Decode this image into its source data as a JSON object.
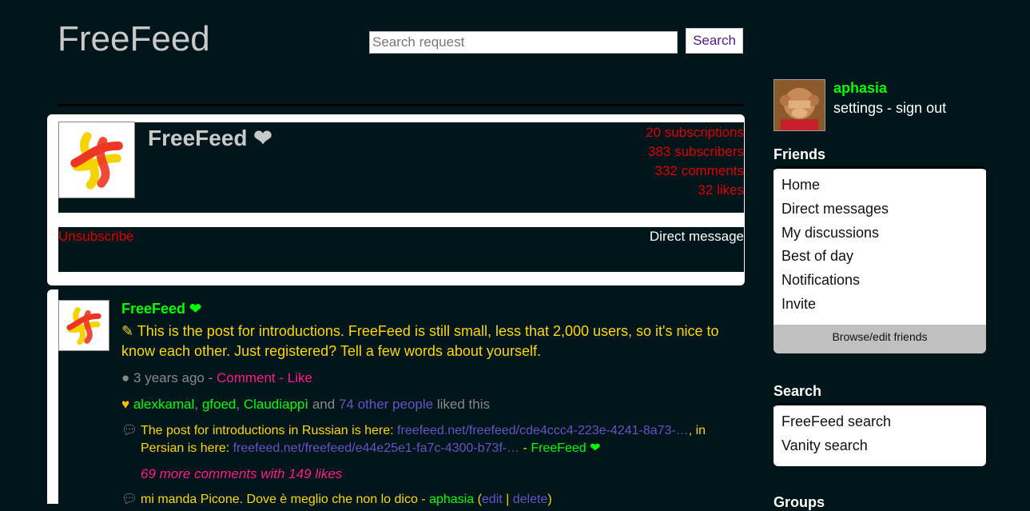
{
  "header": {
    "logo": "FreeFeed",
    "search_placeholder": "Search request",
    "search_button": "Search"
  },
  "profile": {
    "name": "FreeFeed ❤",
    "stats": [
      "20 subscriptions",
      "383 subscribers",
      "332 comments",
      "32 likes"
    ],
    "unsubscribe": "Unsubscribe",
    "direct_message": "Direct message"
  },
  "post": {
    "author": "FreeFeed ❤",
    "body": "This is the post for introductions. FreeFeed is still small, less that 2,000 users, so it's nice to know each other. Just registered? Tell a few words about yourself.",
    "time": "3 years ago",
    "sep": " - ",
    "comment": "Comment",
    "like": "Like",
    "likers": [
      "alexkamal",
      "gfoed",
      "Claudiappì"
    ],
    "likes_and": "and",
    "likes_others": "74 other people",
    "likes_tail": "liked this",
    "comment1": {
      "text1": "The post for introductions in Russian is here: ",
      "link1": "freefeed.net/freefeed/cde4ccc4-223e-4241-8a73-…",
      "text2": ", in Persian is here: ",
      "link2": "freefeed.net/freefeed/e44e25e1-fa7c-4300-b73f-…",
      "dash": " - ",
      "author": "FreeFeed ❤"
    },
    "more_comments": "69 more comments with 149 likes",
    "comment2": {
      "text": "mi manda Picone. Dove è meglio che non lo dico",
      "dash": " - ",
      "author": "aphasia",
      "open": " (",
      "edit": "edit",
      "bar": " | ",
      "delete": "delete",
      "close": ")"
    }
  },
  "user": {
    "name": "aphasia",
    "settings": "settings",
    "sep": " - ",
    "signout": "sign out"
  },
  "sidebar": {
    "friends_title": "Friends",
    "friends_items": [
      "Home",
      "Direct messages",
      "My discussions",
      "Best of day",
      "Notifications",
      "Invite"
    ],
    "browse": "Browse/edit friends",
    "search_title": "Search",
    "search_items": [
      "FreeFeed search",
      "Vanity search"
    ],
    "groups_title": "Groups"
  }
}
